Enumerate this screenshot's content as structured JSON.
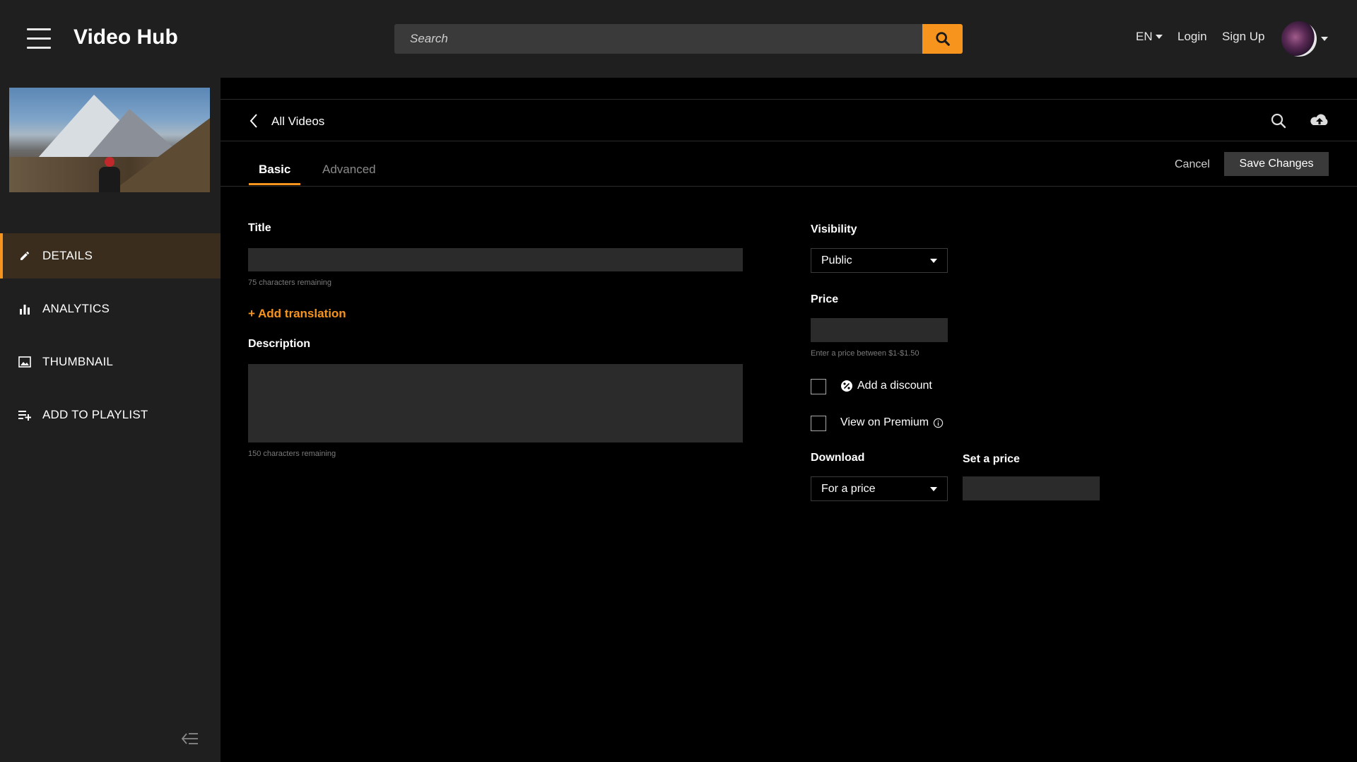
{
  "header": {
    "app_title": "Video Hub",
    "search_placeholder": "Search",
    "lang": "EN",
    "login": "Login",
    "signup": "Sign Up"
  },
  "sidebar": {
    "items": [
      {
        "label": "DETAILS",
        "icon": "pencil-icon",
        "active": true
      },
      {
        "label": "ANALYTICS",
        "icon": "bar-chart-icon",
        "active": false
      },
      {
        "label": "THUMBNAIL",
        "icon": "image-icon",
        "active": false
      },
      {
        "label": "ADD TO PLAYLIST",
        "icon": "playlist-add-icon",
        "active": false
      }
    ]
  },
  "breadcrumb": {
    "label": "All Videos"
  },
  "tabs": {
    "basic": "Basic",
    "advanced": "Advanced"
  },
  "actions": {
    "cancel": "Cancel",
    "save": "Save Changes"
  },
  "form": {
    "title_label": "Title",
    "title_value": "",
    "title_hint": "75 characters remaining",
    "add_translation": "+ Add translation",
    "description_label": "Description",
    "description_value": "",
    "description_hint": "150 characters remaining",
    "visibility_label": "Visibility",
    "visibility_value": "Public",
    "price_label": "Price",
    "price_value": "",
    "price_hint": "Enter a price between $1-$1.50",
    "discount_label": "Add a discount",
    "premium_label": "View on Premium",
    "download_label": "Download",
    "download_value": "For a price",
    "set_price_label": "Set a price",
    "set_price_value": ""
  },
  "colors": {
    "accent": "#f7941d",
    "bg": "#000000",
    "panel": "#1f1f1f",
    "field": "#2b2b2b"
  }
}
